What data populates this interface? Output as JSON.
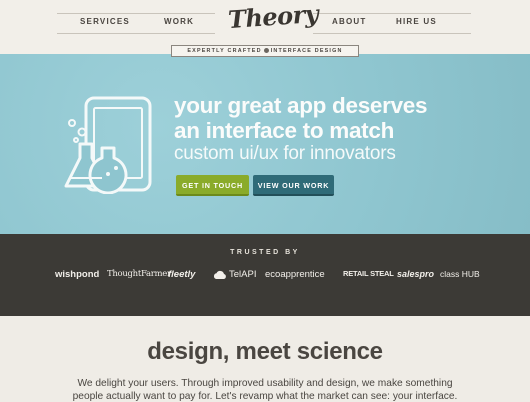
{
  "nav": {
    "items": [
      {
        "label": "SERVICES"
      },
      {
        "label": "WORK"
      },
      {
        "label": "ABOUT"
      },
      {
        "label": "HIRE US"
      }
    ],
    "logo_text": "Theory"
  },
  "tagline": {
    "left": "EXPERTLY CRAFTED",
    "right": "INTERFACE DESIGN"
  },
  "hero": {
    "headline_line1": "your great app deserves",
    "headline_line2": "an interface to match",
    "subline": "custom ui/ux for innovators",
    "primary_cta": "GET IN TOUCH",
    "secondary_cta": "VIEW OUR WORK"
  },
  "trusted": {
    "label": "TRUSTED BY",
    "logos": [
      {
        "name": "wishpond",
        "text": "wishpond"
      },
      {
        "name": "thoughtfarmer",
        "text": "ThoughtFarmer"
      },
      {
        "name": "fleetly",
        "text": "fleetly"
      },
      {
        "name": "telapi",
        "text": "TelAPI"
      },
      {
        "name": "ecoapprentice",
        "text": "ecoapprentice"
      },
      {
        "name": "retailsteal",
        "text": "RETAIL STEAL"
      },
      {
        "name": "salespro",
        "text": "salespro"
      },
      {
        "name": "classhub",
        "text": "class HUB"
      }
    ]
  },
  "content": {
    "heading": "design, meet science",
    "paragraph_line1": "We delight your users. Through improved usability and design, we make something",
    "paragraph_line2": "people actually want to pay for. Let's revamp what the market can see: your interface."
  },
  "colors": {
    "hero_bg": "#8ec5cf",
    "trusted_bg": "#3c3a36",
    "primary_cta": "#8aab2a",
    "secondary_cta": "#2f6b78",
    "page_bg": "#efece6"
  },
  "icons": [
    "tablet-icon",
    "flask-icon",
    "bubbles-icon"
  ]
}
